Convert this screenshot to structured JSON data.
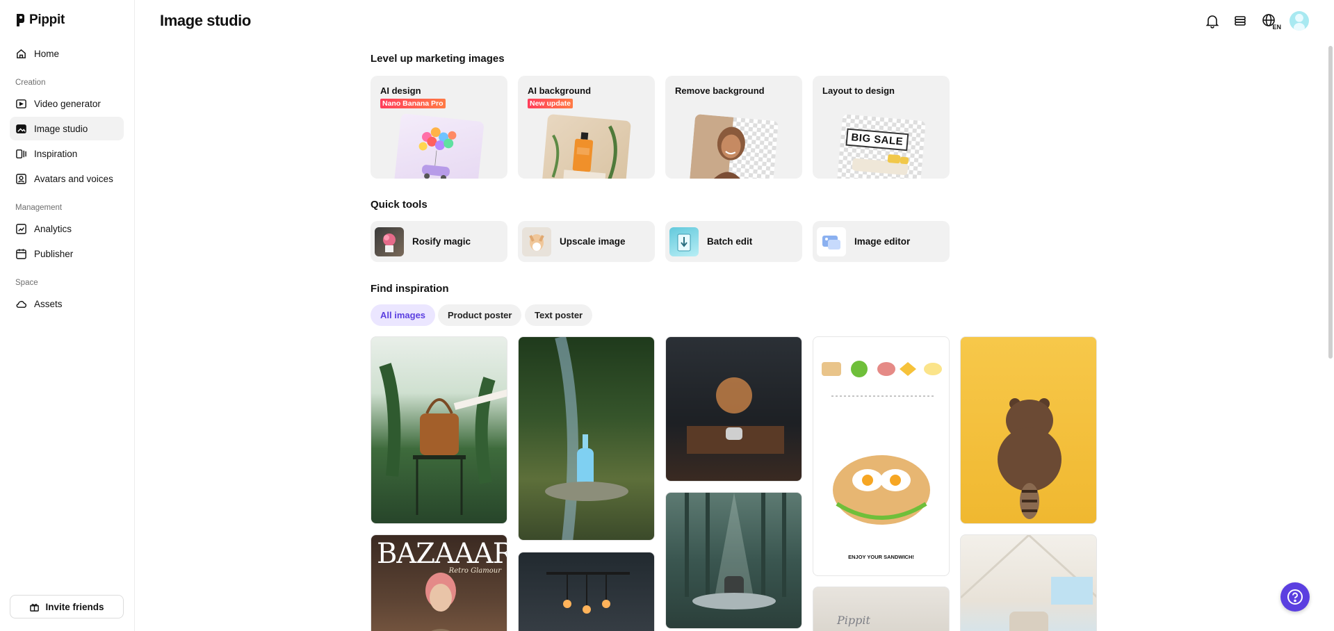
{
  "app": {
    "brand": "Pippit",
    "accent_color": "#5b3fe0"
  },
  "header": {
    "title": "Image studio",
    "icons": [
      "bell-icon",
      "stack-icon",
      "globe-icon",
      "user-avatar"
    ],
    "language": "EN"
  },
  "sidebar": {
    "home": "Home",
    "section_creation": "Creation",
    "video_generator": "Video generator",
    "image_studio": "Image studio",
    "inspiration": "Inspiration",
    "avatars_voices": "Avatars and voices",
    "section_management": "Management",
    "analytics": "Analytics",
    "publisher": "Publisher",
    "section_space": "Space",
    "assets": "Assets",
    "invite": "Invite friends"
  },
  "marketing": {
    "title": "Level up marketing images",
    "cards": [
      {
        "title": "AI design",
        "badge": "Nano Banana Pro"
      },
      {
        "title": "AI background",
        "badge": "New update"
      },
      {
        "title": "Remove background",
        "badge": ""
      },
      {
        "title": "Layout to design",
        "badge": ""
      }
    ],
    "layout_art_text": "BIG SALE"
  },
  "quick_tools": {
    "title": "Quick tools",
    "items": [
      "Rosify magic",
      "Upscale image",
      "Batch edit",
      "Image editor"
    ]
  },
  "inspiration": {
    "title": "Find inspiration",
    "filters": [
      "All images",
      "Product poster",
      "Text poster"
    ],
    "active_filter": "All images",
    "poster_texts": {
      "magazine": "BAZAAAR",
      "magazine_sub": "Retro Glamour",
      "sandwich_caption": "ENJOY YOUR SANDWICH!",
      "brand_box": "Pippit"
    }
  }
}
